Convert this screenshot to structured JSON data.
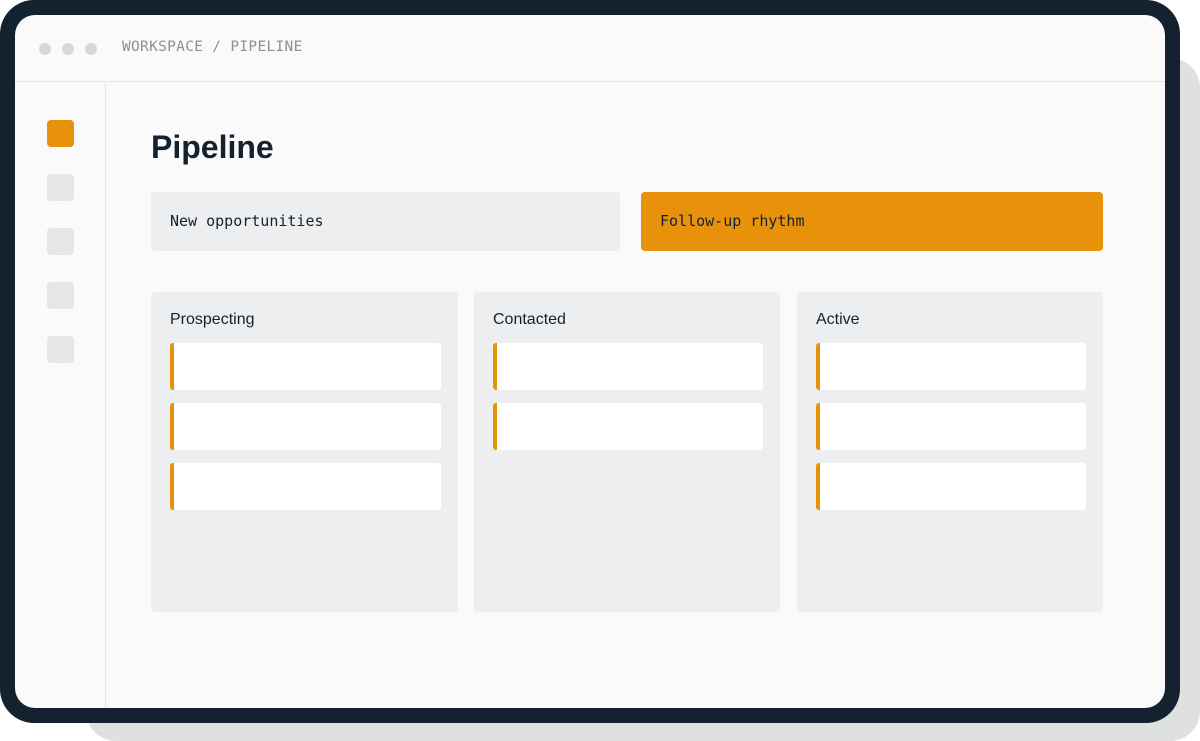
{
  "window": {
    "breadcrumb": "WORKSPACE / PIPELINE"
  },
  "sidebar": {
    "items": [
      {
        "name": "nav-item-1",
        "active": true
      },
      {
        "name": "nav-item-2",
        "active": false
      },
      {
        "name": "nav-item-3",
        "active": false
      },
      {
        "name": "nav-item-4",
        "active": false
      },
      {
        "name": "nav-item-5",
        "active": false
      }
    ]
  },
  "main": {
    "title": "Pipeline",
    "filters": [
      {
        "label": "New opportunities",
        "selected": false
      },
      {
        "label": "Follow-up rhythm",
        "selected": true
      }
    ],
    "columns": [
      {
        "title": "Prospecting",
        "card_count": 3
      },
      {
        "title": "Contacted",
        "card_count": 2
      },
      {
        "title": "Active",
        "card_count": 3
      }
    ]
  },
  "colors": {
    "frame": "#14222f",
    "accent": "#e8910a",
    "panel": "#eceeef",
    "screen": "#fafafa",
    "text": "#14222f",
    "muted": "#8b9096"
  }
}
